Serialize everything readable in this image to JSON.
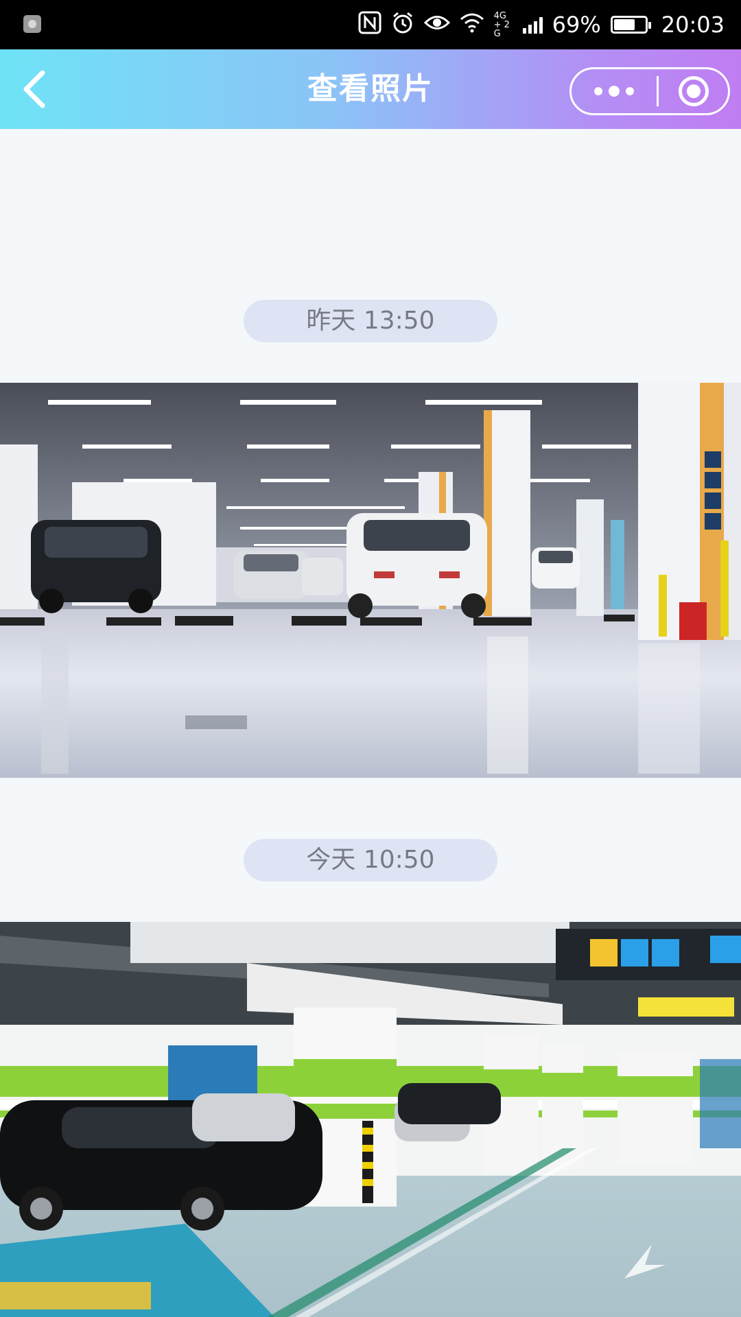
{
  "status_bar": {
    "battery_percent": "69%",
    "time": "20:03",
    "network": "4G+ 2G",
    "battery_level": 0.69,
    "icons": [
      "app-icon",
      "nfc-icon",
      "alarm-icon",
      "eye-icon",
      "wifi-icon",
      "signal-icon",
      "battery-icon"
    ]
  },
  "nav": {
    "title": "查看照片",
    "back_icon": "chevron-left-icon",
    "more_icon": "more-dots-icon",
    "close_icon": "target-circle-icon"
  },
  "photos": [
    {
      "time_label": "昨天 13:50",
      "image": "underground-parking-lot-photo"
    },
    {
      "time_label": "今天 10:50",
      "image": "green-striped-parking-garage-photo"
    }
  ],
  "colors": {
    "nav_gradient_start": "#6fe3f6",
    "nav_gradient_end": "#c07df2",
    "chip_background": "#dfe4f4",
    "page_background": "#f5f8fa"
  }
}
